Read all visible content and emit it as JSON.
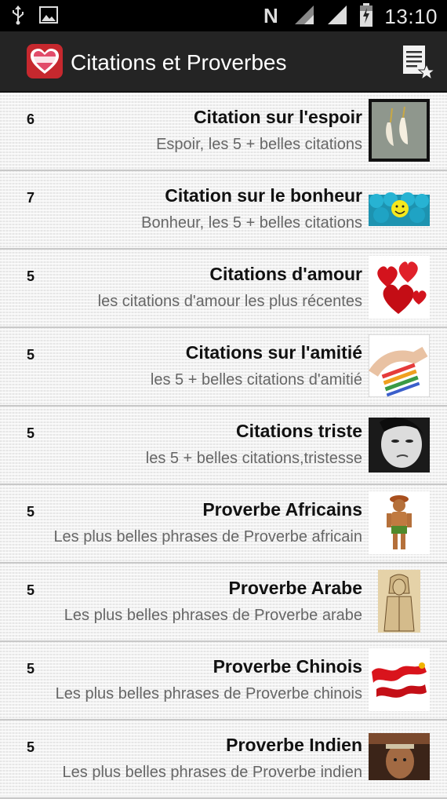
{
  "status_bar": {
    "time": "13:10",
    "icons": [
      "usb-icon",
      "image-icon",
      "nfc-icon",
      "wifi-icon",
      "signal-icon",
      "battery-charging-icon"
    ]
  },
  "action_bar": {
    "app_icon": "citations-heart-icon",
    "title": "Citations et Proverbes",
    "menu_icon": "favorites-list-icon"
  },
  "items": [
    {
      "count": "6",
      "title": "Citation sur l'espoir",
      "subtitle": "Espoir, les 5 + belles citations",
      "thumb": "shell-earrings-image"
    },
    {
      "count": "7",
      "title": "Citation sur le bonheur",
      "subtitle": "Bonheur, les 5 + belles citations",
      "thumb": "smiley-balls-image"
    },
    {
      "count": "5",
      "title": "Citations d'amour",
      "subtitle": "les citations d'amour les plus récentes",
      "thumb": "red-hearts-image"
    },
    {
      "count": "5",
      "title": "Citations sur l'amitié",
      "subtitle": "les 5 + belles citations d'amitié",
      "thumb": "friendship-bracelets-image"
    },
    {
      "count": "5",
      "title": "Citations triste",
      "subtitle": "les 5 + belles citations,tristesse",
      "thumb": "sad-face-image"
    },
    {
      "count": "5",
      "title": "Proverbe Africains",
      "subtitle": "Les plus belles phrases de Proverbe africain",
      "thumb": "african-figure-image"
    },
    {
      "count": "5",
      "title": "Proverbe Arabe",
      "subtitle": "Les plus belles phrases de Proverbe arabe",
      "thumb": "arab-drawing-image"
    },
    {
      "count": "5",
      "title": "Proverbe Chinois",
      "subtitle": "Les plus belles phrases de Proverbe chinois",
      "thumb": "red-dragon-image"
    },
    {
      "count": "5",
      "title": "Proverbe Indien",
      "subtitle": "Les plus belles phrases de Proverbe indien",
      "thumb": "indian-portrait-image"
    }
  ]
}
